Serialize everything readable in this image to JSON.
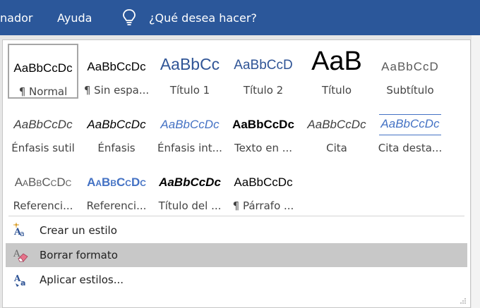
{
  "ribbon": {
    "tabs": [
      "nador",
      "Ayuda"
    ],
    "tell_me": "¿Qué desea hacer?"
  },
  "styles": [
    {
      "sample": "AaBbCcDc",
      "label": "¶ Normal",
      "selected": true
    },
    {
      "sample": "AaBbCcDc",
      "label": "¶ Sin espa..."
    },
    {
      "sample": "AaBbCc",
      "label": "Título 1"
    },
    {
      "sample": "AaBbCcD",
      "label": "Título 2"
    },
    {
      "sample": "AaB",
      "label": "Título"
    },
    {
      "sample": "AaBbCcD",
      "label": "Subtítulo"
    },
    {
      "sample": "AaBbCcDc",
      "label": "Énfasis sutil"
    },
    {
      "sample": "AaBbCcDc",
      "label": "Énfasis"
    },
    {
      "sample": "AaBbCcDc",
      "label": "Énfasis int..."
    },
    {
      "sample": "AaBbCcDc",
      "label": "Texto en ..."
    },
    {
      "sample": "AaBbCcDc",
      "label": "Cita"
    },
    {
      "sample": "AaBbCcDc",
      "label": "Cita desta..."
    },
    {
      "sample": "AaBbCcDc",
      "label": "Referenci..."
    },
    {
      "sample": "AaBbCcDc",
      "label": "Referenci..."
    },
    {
      "sample": "AaBbCcDc",
      "label": "Título del ..."
    },
    {
      "sample": "AaBbCcDc",
      "label": "¶ Párrafo ..."
    }
  ],
  "commands": [
    {
      "label": "Crear un estilo",
      "icon": "new-style-icon"
    },
    {
      "label": "Borrar formato",
      "icon": "clear-formatting-icon",
      "highlighted": true
    },
    {
      "label": "Aplicar estilos...",
      "icon": "apply-styles-icon"
    }
  ],
  "colors": {
    "ribbon": "#2b579a",
    "heading_blue": "#2f5496",
    "hover_gray": "#c8c8c8"
  }
}
